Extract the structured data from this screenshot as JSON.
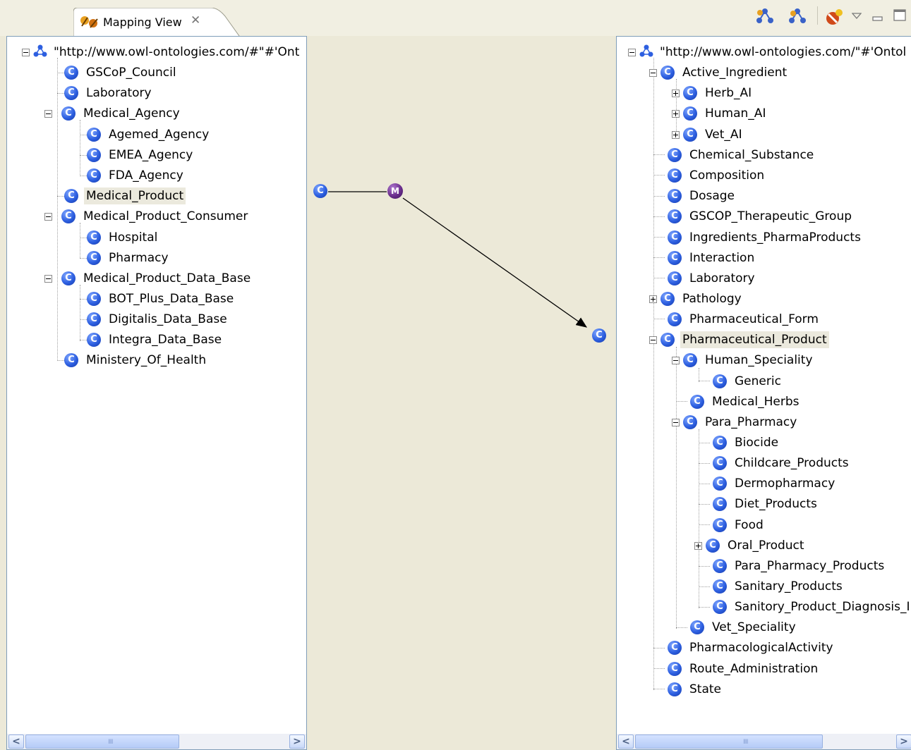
{
  "tab": {
    "title": "Mapping View",
    "close_glyph": "✕",
    "icon": "mapping-view-icon"
  },
  "toolbar": {
    "icons": [
      "ontology-mapping-icon",
      "ontology-icon",
      "remove-mapping-icon",
      "view-menu-icon",
      "minimize-icon",
      "maximize-icon"
    ]
  },
  "left_tree": {
    "root": "\"http://www.owl-ontologies.com/#\"#'Ont",
    "items": [
      {
        "label": "GSCoP_Council"
      },
      {
        "label": "Laboratory"
      },
      {
        "label": "Medical_Agency"
      },
      {
        "label": "Agemed_Agency"
      },
      {
        "label": "EMEA_Agency"
      },
      {
        "label": "FDA_Agency"
      },
      {
        "label": "Medical_Product",
        "selected": true
      },
      {
        "label": "Medical_Product_Consumer"
      },
      {
        "label": "Hospital"
      },
      {
        "label": "Pharmacy"
      },
      {
        "label": "Medical_Product_Data_Base"
      },
      {
        "label": "BOT_Plus_Data_Base"
      },
      {
        "label": "Digitalis_Data_Base"
      },
      {
        "label": "Integra_Data_Base"
      },
      {
        "label": "Ministery_Of_Health"
      }
    ]
  },
  "right_tree": {
    "root": "\"http://www.owl-ontologies.com/\"#'Ontol",
    "items": [
      {
        "label": "Active_Ingredient"
      },
      {
        "label": "Herb_AI"
      },
      {
        "label": "Human_AI"
      },
      {
        "label": "Vet_AI"
      },
      {
        "label": "Chemical_Substance"
      },
      {
        "label": "Composition"
      },
      {
        "label": "Dosage"
      },
      {
        "label": "GSCOP_Therapeutic_Group"
      },
      {
        "label": "Ingredients_PharmaProducts"
      },
      {
        "label": "Interaction"
      },
      {
        "label": "Laboratory"
      },
      {
        "label": "Pathology"
      },
      {
        "label": "Pharmaceutical_Form"
      },
      {
        "label": "Pharmaceutical_Product",
        "selected": true
      },
      {
        "label": "Human_Speciality"
      },
      {
        "label": "Generic"
      },
      {
        "label": "Medical_Herbs"
      },
      {
        "label": "Para_Pharmacy"
      },
      {
        "label": "Biocide"
      },
      {
        "label": "Childcare_Products"
      },
      {
        "label": "Dermopharmacy"
      },
      {
        "label": "Diet_Products"
      },
      {
        "label": "Food"
      },
      {
        "label": "Oral_Product"
      },
      {
        "label": "Para_Pharmacy_Products"
      },
      {
        "label": "Sanitary_Products"
      },
      {
        "label": "Sanitory_Product_Diagnosis_I"
      },
      {
        "label": "Vet_Speciality"
      },
      {
        "label": "PharmacologicalActivity"
      },
      {
        "label": "Route_Administration"
      },
      {
        "label": "State"
      }
    ]
  },
  "mapping": {
    "source_node": "C",
    "mapping_node": "M",
    "target_node": "C"
  },
  "scrollbars": {
    "left_arrow": "<",
    "right_arrow": ">",
    "grip": "IIII"
  },
  "colors": {
    "class_icon": "#2d5fe0",
    "mapping_node": "#6a2d8c",
    "selection": "#ebe9dd",
    "pane_border": "#7f9db9"
  }
}
